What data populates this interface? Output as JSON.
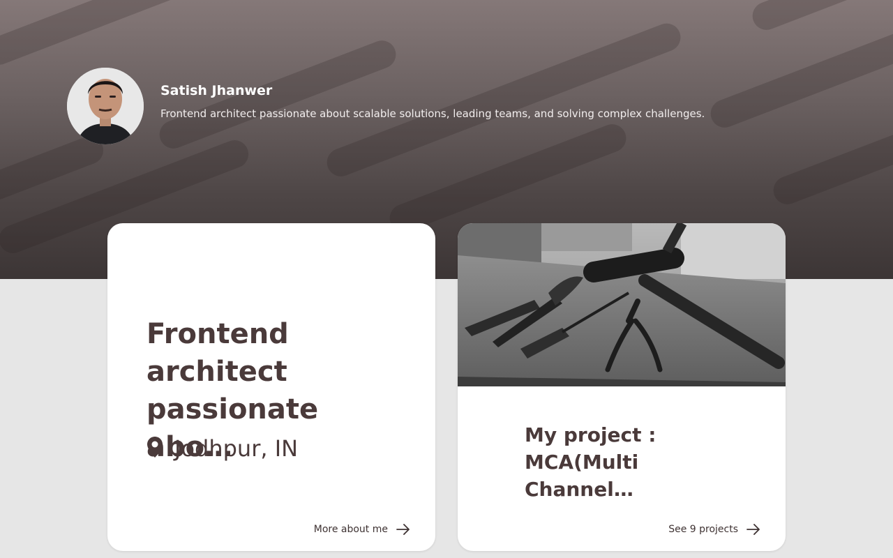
{
  "profile": {
    "name": "Satish Jhanwer",
    "bio": "Frontend architect passionate about scalable solutions, leading teams, and solving complex challenges."
  },
  "about_card": {
    "heading_lines": [
      "Frontend",
      "architect",
      "passionate abo…"
    ],
    "location": "Jodhpur, IN",
    "location_icon": "map-pin-icon",
    "link_label": "More about me",
    "link_icon": "arrow-right-icon"
  },
  "project_card": {
    "image_subject": "tools-on-workbench",
    "heading_lines": [
      "My project :",
      "MCA(Multi",
      "Channel…"
    ],
    "link_label": "See 9 projects",
    "link_icon": "arrow-right-icon"
  },
  "colors": {
    "hero_top": "#857878",
    "hero_bottom": "#3c3535",
    "page_background": "#e6e6e6",
    "card_background": "#ffffff",
    "heading_text": "#4a3a3a"
  }
}
